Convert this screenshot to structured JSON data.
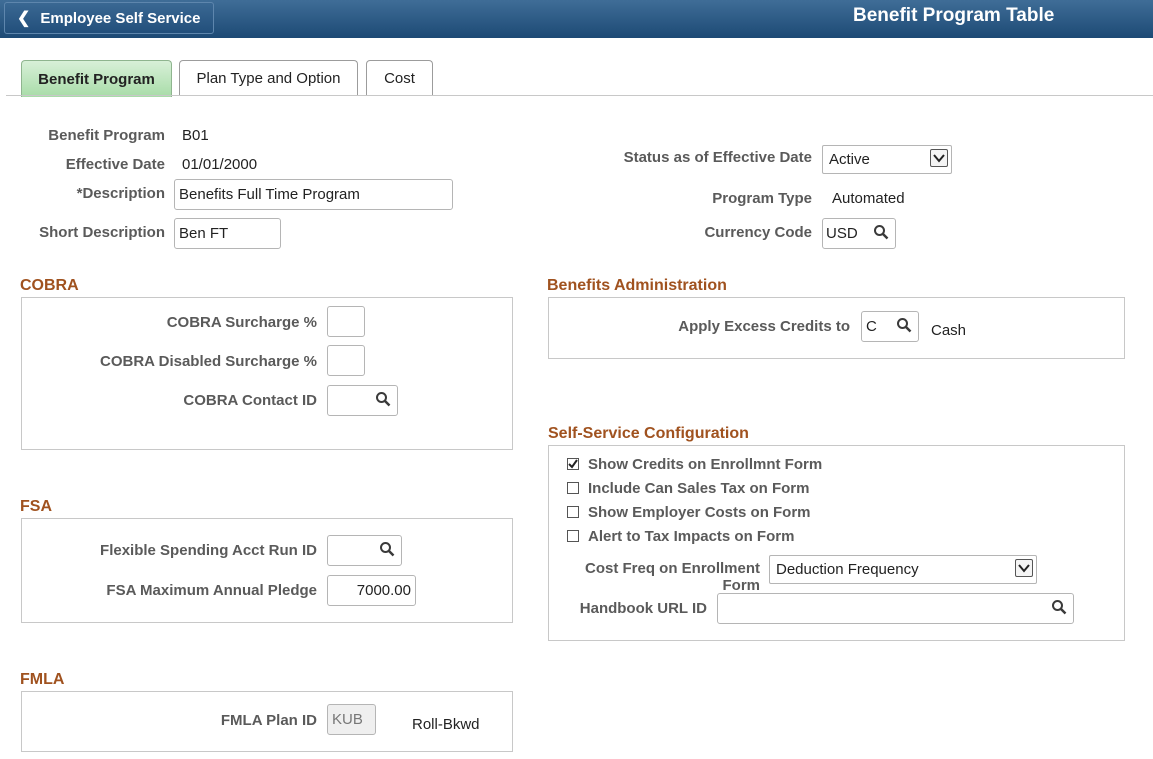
{
  "header": {
    "back_label": "Employee Self Service",
    "title": "Benefit Program Table"
  },
  "tabs": [
    {
      "label": "Benefit Program",
      "active": true
    },
    {
      "label": "Plan Type and Option",
      "active": false
    },
    {
      "label": "Cost",
      "active": false
    }
  ],
  "program": {
    "benefit_program_label": "Benefit Program",
    "benefit_program_value": "B01",
    "effective_date_label": "Effective Date",
    "effective_date_value": "01/01/2000",
    "description_label": "*Description",
    "description_value": "Benefits Full Time Program",
    "short_description_label": "Short Description",
    "short_description_value": "Ben FT",
    "status_label": "Status as of Effective Date",
    "status_value": "Active",
    "program_type_label": "Program Type",
    "program_type_value": "Automated",
    "currency_label": "Currency Code",
    "currency_value": "USD"
  },
  "cobra": {
    "title": "COBRA",
    "surcharge_label": "COBRA Surcharge %",
    "surcharge_value": "",
    "disabled_surcharge_label": "COBRA Disabled Surcharge %",
    "disabled_surcharge_value": "",
    "contact_id_label": "COBRA Contact ID",
    "contact_id_value": ""
  },
  "benefits_admin": {
    "title": "Benefits Administration",
    "apply_excess_label": "Apply Excess Credits to",
    "apply_excess_value": "C",
    "apply_excess_desc": "Cash"
  },
  "self_service": {
    "title": "Self-Service Configuration",
    "checkboxes": [
      {
        "label": "Show Credits on Enrollmnt Form",
        "checked": true
      },
      {
        "label": "Include Can Sales Tax on Form",
        "checked": false
      },
      {
        "label": "Show Employer Costs on Form",
        "checked": false
      },
      {
        "label": "Alert to Tax Impacts on Form",
        "checked": false
      }
    ],
    "cost_freq_label_line1": "Cost Freq on Enrollment",
    "cost_freq_label_line2": "Form",
    "cost_freq_value": "Deduction Frequency",
    "handbook_label": "Handbook URL ID",
    "handbook_value": ""
  },
  "fsa": {
    "title": "FSA",
    "run_id_label": "Flexible Spending Acct Run ID",
    "run_id_value": "",
    "max_pledge_label": "FSA Maximum Annual Pledge",
    "max_pledge_value": "7000.00"
  },
  "fmla": {
    "title": "FMLA",
    "plan_id_label": "FMLA Plan ID",
    "plan_id_value": "KUB",
    "plan_id_desc": "Roll-Bkwd"
  },
  "icons": {
    "back": "chevron-left-icon",
    "lookup": "magnifier-icon",
    "dropdown": "chevron-down-icon",
    "checkbox": "checkmark-icon"
  },
  "colors": {
    "header_bg": "#1d4a75",
    "active_tab": "#a8dca8",
    "section_title": "#a0521f"
  }
}
